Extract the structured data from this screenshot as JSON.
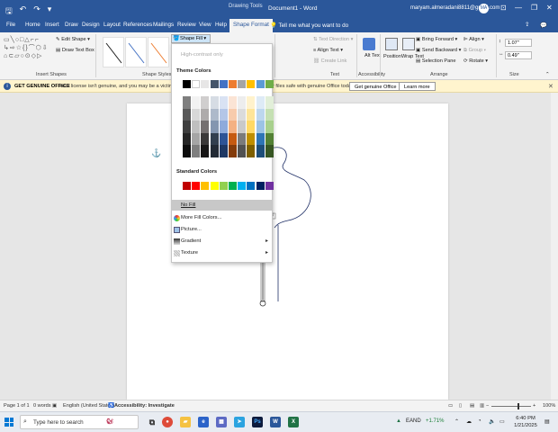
{
  "titlebar": {
    "autosave_icon": "save-icon",
    "undo_icon": "undo-icon",
    "redo_icon": "redo-icon",
    "context_label": "Drawing Tools",
    "doc_title": "Document1  -  Word",
    "user": "maryam.almeradani8811@gmail.com",
    "avatar_initials": "MA",
    "minimize": "—",
    "restore": "❐",
    "close": "✕"
  },
  "tabs": [
    "File",
    "Home",
    "Insert",
    "Draw",
    "Design",
    "Layout",
    "References",
    "Mailings",
    "Review",
    "View",
    "Help",
    "Shape Format"
  ],
  "active_tab": "Shape Format",
  "tellme": "Tell me what you want to do",
  "ribbon": {
    "edit_shape": "Edit Shape",
    "draw_text_box": "Draw Text Box",
    "insert_shapes_label": "Insert Shapes",
    "shape_styles_label": "Shape Styles",
    "shape_fill": "Shape Fill",
    "text_direction": "Text Direction",
    "align_text": "Align Text",
    "create_link": "Create Link",
    "text_label": "Text",
    "alt_text": "Alt Text",
    "accessibility_label": "Accessibility",
    "position": "Position",
    "wrap_text": "Wrap Text",
    "bring_forward": "Bring Forward",
    "send_backward": "Send Backward",
    "selection_pane": "Selection Pane",
    "align": "Align",
    "group": "Group",
    "rotate": "Rotate",
    "arrange_label": "Arrange",
    "height": "1.07\"",
    "width": "0.49\"",
    "size_label": "Size"
  },
  "notice": {
    "head": "GET GENUINE OFFICE",
    "message": "Your license isn't genuine, and you may be a victim of soft",
    "message_tail": "r files safe with genuine Office today.",
    "btn_genuine": "Get genuine Office",
    "btn_learn": "Learn more"
  },
  "dropdown": {
    "high_contrast": "High-contrast only",
    "theme_colors": "Theme Colors",
    "standard_colors": "Standard Colors",
    "no_fill": "No Fill",
    "more_fill": "More Fill Colors...",
    "picture": "Picture...",
    "gradient": "Gradient",
    "texture": "Texture",
    "theme_top": [
      "#000000",
      "#ffffff",
      "#e7e6e6",
      "#44546a",
      "#4472c4",
      "#ed7d31",
      "#a5a5a5",
      "#ffc000",
      "#5b9bd5",
      "#70ad47"
    ],
    "theme_shades": [
      [
        "#7f7f7f",
        "#f2f2f2",
        "#d0cece",
        "#d6dce4",
        "#d9e2f3",
        "#fbe4d5",
        "#ededed",
        "#fff2cc",
        "#deebf6",
        "#e2efd9"
      ],
      [
        "#595959",
        "#d8d8d8",
        "#aeabab",
        "#adb9ca",
        "#b4c6e7",
        "#f7cbac",
        "#dbdbdb",
        "#fee599",
        "#bdd7ee",
        "#c5e0b3"
      ],
      [
        "#3f3f3f",
        "#bfbfbf",
        "#757070",
        "#8496b0",
        "#8eaadb",
        "#f4b183",
        "#c9c9c9",
        "#ffd965",
        "#9cc3e5",
        "#a8d08d"
      ],
      [
        "#262626",
        "#a5a5a5",
        "#3a3838",
        "#323f4f",
        "#2f5496",
        "#c55a11",
        "#7b7b7b",
        "#bf8f00",
        "#2e75b5",
        "#538135"
      ],
      [
        "#0d0d0d",
        "#7f7f7f",
        "#171616",
        "#222a35",
        "#1f3864",
        "#843c0b",
        "#525252",
        "#7f6000",
        "#1e4e79",
        "#375623"
      ]
    ],
    "standard": [
      "#c00000",
      "#ff0000",
      "#ffc000",
      "#ffff00",
      "#92d050",
      "#00b050",
      "#00b0f0",
      "#0070c0",
      "#002060",
      "#7030a0"
    ]
  },
  "status": {
    "page": "Page 1 of 1",
    "words": "0 words",
    "language": "English (United States)",
    "accessibility": "Accessibility: Investigate",
    "zoom": "100%"
  },
  "taskbar": {
    "search_placeholder": "Type here to search",
    "stock": "EAND",
    "stock_change": "+1.71%",
    "time": "6:40 PM",
    "date": "1/21/2025"
  }
}
